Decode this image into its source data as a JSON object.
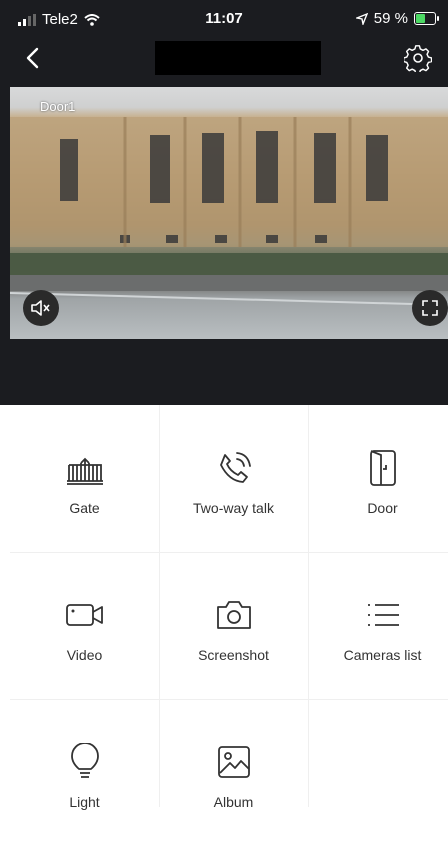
{
  "status_bar": {
    "carrier": "Tele2",
    "time": "11:07",
    "battery": "59 %",
    "battery_level": 0.59
  },
  "camera": {
    "label": "Door1"
  },
  "actions": [
    {
      "label": "Gate",
      "icon": "gate-icon"
    },
    {
      "label": "Two-way talk",
      "icon": "phone-icon"
    },
    {
      "label": "Door",
      "icon": "door-icon"
    },
    {
      "label": "Video",
      "icon": "video-camera-icon"
    },
    {
      "label": "Screenshot",
      "icon": "camera-icon"
    },
    {
      "label": "Cameras list",
      "icon": "list-icon"
    },
    {
      "label": "Light",
      "icon": "light-bulb-icon"
    },
    {
      "label": "Album",
      "icon": "image-icon"
    }
  ],
  "colors": {
    "header_bg": "#1b1c20",
    "battery_green": "#4cd964"
  }
}
